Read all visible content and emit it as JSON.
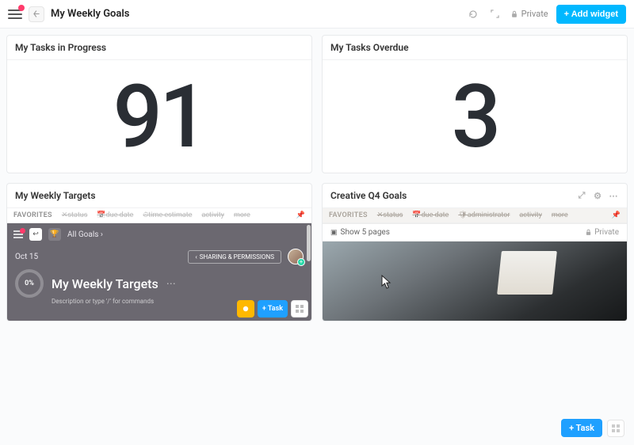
{
  "header": {
    "title": "My Weekly Goals",
    "privacy_label": "Private",
    "add_widget_label": "+ Add widget"
  },
  "widgets": {
    "tasks_in_progress": {
      "title": "My Tasks in Progress",
      "value": "91"
    },
    "tasks_overdue": {
      "title": "My Tasks Overdue",
      "value": "3"
    },
    "weekly_targets": {
      "title": "My Weekly Targets",
      "favorites_label": "FAVORITES",
      "filters": {
        "status": "status",
        "due_date": "due date",
        "time_estimate": "time estimate",
        "activity": "activity",
        "more": "more"
      },
      "all_goals_label": "All Goals",
      "date_label": "Oct 15",
      "share_label": "SHARING & PERMISSIONS",
      "progress": "0%",
      "embed_title": "My Weekly Targets",
      "desc_hint": "Description or type '/' for commands",
      "task_btn": "+ Task"
    },
    "creative_goals": {
      "title": "Creative Q4 Goals",
      "favorites_label": "FAVORITES",
      "filters": {
        "status": "status",
        "due_date": "due date",
        "administrator": "administrator",
        "activity": "activity",
        "more": "more"
      },
      "show_pages_label": "Show 5 pages",
      "privacy_label": "Private"
    }
  },
  "floating": {
    "task_btn": "+ Task"
  }
}
